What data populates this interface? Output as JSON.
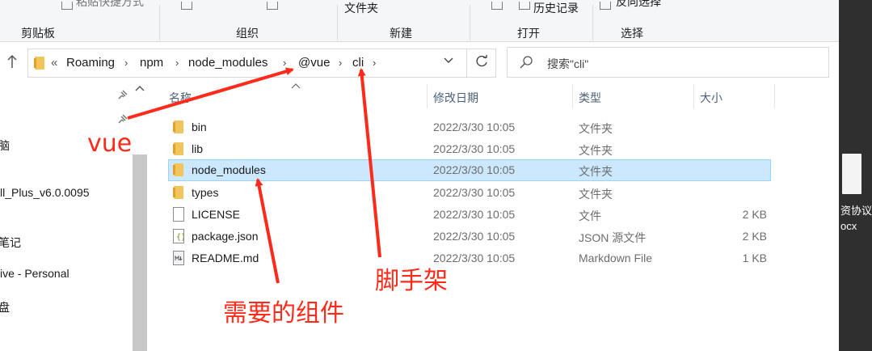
{
  "ribbon": {
    "groups": [
      {
        "top_text": "粘贴快捷方式",
        "label": "剪贴板"
      },
      {
        "top_text": "",
        "label": "组织"
      },
      {
        "top_text": "文件夹",
        "label": "新建"
      },
      {
        "top_text": "历史记录",
        "label": "打开"
      },
      {
        "top_text": "反向选择",
        "label": "选择"
      }
    ]
  },
  "address": {
    "overflow": "«",
    "crumbs": [
      "Roaming",
      "npm",
      "node_modules",
      "@vue",
      "cli"
    ]
  },
  "search": {
    "placeholder": "搜索\"cli\""
  },
  "navpane": {
    "items": [
      "脑",
      "ll_Plus_v6.0.0095",
      "笔记",
      "ive - Personal",
      "盘"
    ]
  },
  "columns": {
    "name": "名称",
    "date": "修改日期",
    "type": "类型",
    "size": "大小"
  },
  "files": [
    {
      "name": "bin",
      "date": "2022/3/30 10:05",
      "type": "文件夹",
      "size": "",
      "icon": "folder-icon"
    },
    {
      "name": "lib",
      "date": "2022/3/30 10:05",
      "type": "文件夹",
      "size": "",
      "icon": "folder-icon"
    },
    {
      "name": "node_modules",
      "date": "2022/3/30 10:05",
      "type": "文件夹",
      "size": "",
      "icon": "folder-icon",
      "selected": true
    },
    {
      "name": "types",
      "date": "2022/3/30 10:05",
      "type": "文件夹",
      "size": "",
      "icon": "folder-icon"
    },
    {
      "name": "LICENSE",
      "date": "2022/3/30 10:05",
      "type": "文件",
      "size": "2 KB",
      "icon": "file-icon"
    },
    {
      "name": "package.json",
      "date": "2022/3/30 10:05",
      "type": "JSON 源文件",
      "size": "2 KB",
      "icon": "json-file-icon"
    },
    {
      "name": "README.md",
      "date": "2022/3/30 10:05",
      "type": "Markdown File",
      "size": "1 KB",
      "icon": "markdown-file-icon"
    }
  ],
  "desktop": {
    "labels": [
      "资协议",
      "ocx"
    ]
  },
  "annotations": {
    "vue": "vue",
    "scaffold": "脚手架",
    "needed": "需要的组件"
  },
  "colors": {
    "annotation": "#ff2a1a",
    "selection_bg": "#cce8ff",
    "selection_border": "#99d1ff",
    "folder": "#f2c55c"
  }
}
